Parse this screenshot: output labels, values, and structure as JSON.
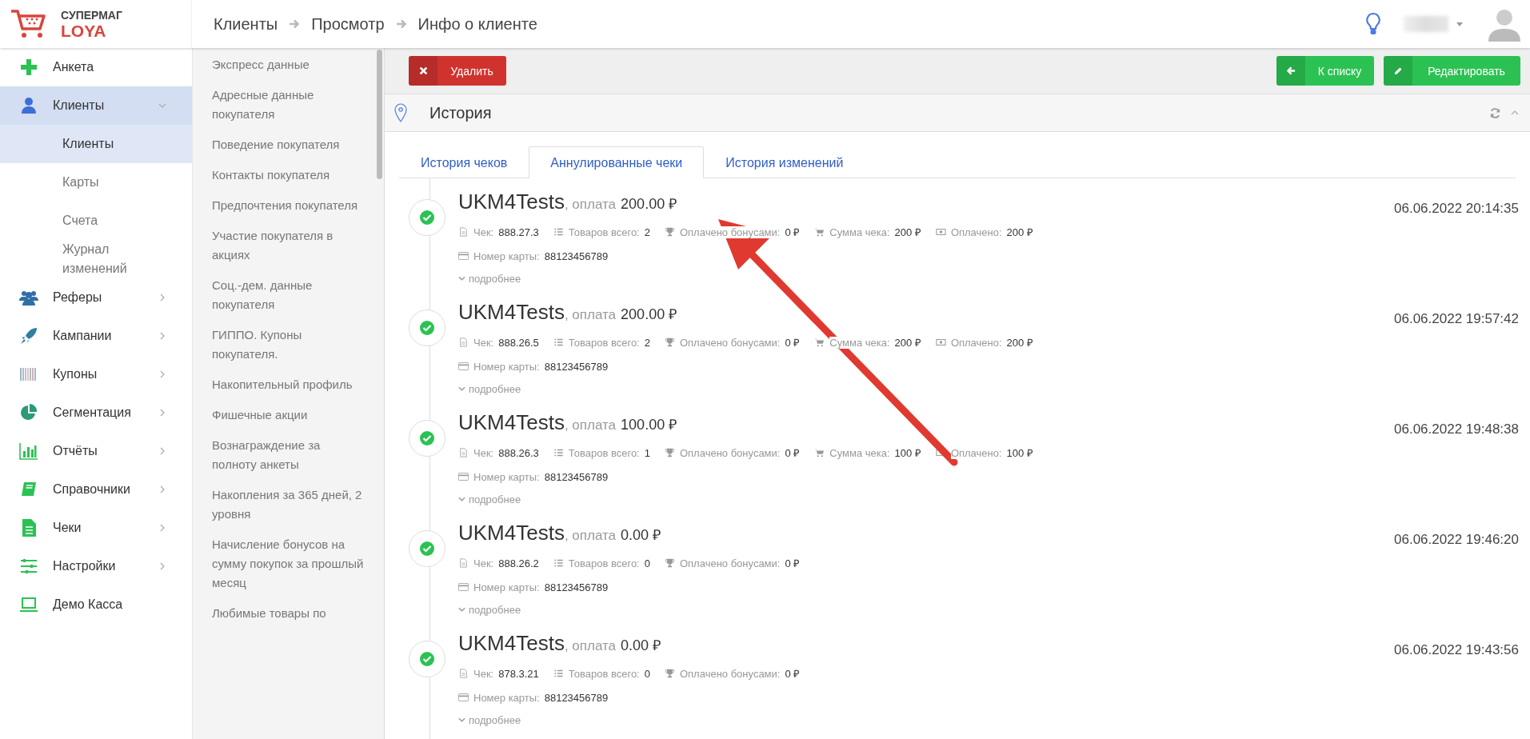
{
  "logo": {
    "top": "СУПЕРМАГ",
    "bottom": "LOYA"
  },
  "breadcrumbs": [
    "Клиенты",
    "Просмотр",
    "Инфо о клиенте"
  ],
  "sidebar": {
    "items": [
      {
        "label": "Анкета",
        "selected": false
      },
      {
        "label": "Клиенты",
        "selected": true,
        "expanded": true,
        "children": [
          {
            "label": "Клиенты",
            "selected": true
          },
          {
            "label": "Карты",
            "selected": false
          },
          {
            "label": "Счета",
            "selected": false
          },
          {
            "label": "Журнал изменений",
            "selected": false
          }
        ]
      },
      {
        "label": "Реферы",
        "selected": false,
        "expanded": false
      },
      {
        "label": "Кампании",
        "selected": false,
        "expanded": false
      },
      {
        "label": "Купоны",
        "selected": false,
        "expanded": false
      },
      {
        "label": "Сегментация",
        "selected": false,
        "expanded": false
      },
      {
        "label": "Отчёты",
        "selected": false,
        "expanded": false
      },
      {
        "label": "Справочники",
        "selected": false,
        "expanded": false
      },
      {
        "label": "Чеки",
        "selected": false,
        "expanded": false
      },
      {
        "label": "Настройки",
        "selected": false,
        "expanded": false
      },
      {
        "label": "Демо Касса",
        "selected": false
      }
    ]
  },
  "submenu": {
    "items": [
      "Экспресс данные",
      "Адресные данные покупателя",
      "Поведение покупателя",
      "Контакты покупателя",
      "Предпочтения покупателя",
      "Участие покупателя в акциях",
      "Соц.-дем. данные покупателя",
      "ГИППО. Купоны покупателя.",
      "Накопительный профиль",
      "Фишечные акции",
      "Вознаграждение за полноту анкеты",
      "Накопления за 365 дней, 2 уровня",
      "Начисление бонусов на сумму покупок за прошлый месяц",
      "Любимые товары по"
    ]
  },
  "actions": {
    "delete": "Удалить",
    "back": "К списку",
    "edit": "Редактировать"
  },
  "panel": {
    "title": "История"
  },
  "tabs": [
    {
      "label": "История чеков",
      "selected": false
    },
    {
      "label": "Аннулированные чеки",
      "selected": true
    },
    {
      "label": "История изменений",
      "selected": false
    }
  ],
  "records": [
    {
      "name": "UKM4Tests",
      "pay_label": ", оплата",
      "amount": "200.00 ₽",
      "time": "06.06.2022 20:14:35",
      "fields": [
        {
          "kind": "receipt",
          "label": "Чек:",
          "value": "888.27.3"
        },
        {
          "kind": "list",
          "label": "Товаров всего:",
          "value": "2"
        },
        {
          "kind": "trophy",
          "label": "Оплачено бонусами:",
          "value": "0 ₽"
        },
        {
          "kind": "cart",
          "label": "Сумма чека:",
          "value": "200 ₽"
        },
        {
          "kind": "cash",
          "label": "Оплачено:",
          "value": "200 ₽"
        }
      ],
      "card_label": "Номер карты:",
      "card": "88123456789",
      "more": "подробнее"
    },
    {
      "name": "UKM4Tests",
      "pay_label": ", оплата",
      "amount": "200.00 ₽",
      "time": "06.06.2022 19:57:42",
      "fields": [
        {
          "kind": "receipt",
          "label": "Чек:",
          "value": "888.26.5"
        },
        {
          "kind": "list",
          "label": "Товаров всего:",
          "value": "2"
        },
        {
          "kind": "trophy",
          "label": "Оплачено бонусами:",
          "value": "0 ₽"
        },
        {
          "kind": "cart",
          "label": "Сумма чека:",
          "value": "200 ₽"
        },
        {
          "kind": "cash",
          "label": "Оплачено:",
          "value": "200 ₽"
        }
      ],
      "card_label": "Номер карты:",
      "card": "88123456789",
      "more": "подробнее"
    },
    {
      "name": "UKM4Tests",
      "pay_label": ", оплата",
      "amount": "100.00 ₽",
      "time": "06.06.2022 19:48:38",
      "fields": [
        {
          "kind": "receipt",
          "label": "Чек:",
          "value": "888.26.3"
        },
        {
          "kind": "list",
          "label": "Товаров всего:",
          "value": "1"
        },
        {
          "kind": "trophy",
          "label": "Оплачено бонусами:",
          "value": "0 ₽"
        },
        {
          "kind": "cart",
          "label": "Сумма чека:",
          "value": "100 ₽"
        },
        {
          "kind": "cash",
          "label": "Оплачено:",
          "value": "100 ₽"
        }
      ],
      "card_label": "Номер карты:",
      "card": "88123456789",
      "more": "подробнее"
    },
    {
      "name": "UKM4Tests",
      "pay_label": ", оплата",
      "amount": "0.00 ₽",
      "time": "06.06.2022 19:46:20",
      "fields": [
        {
          "kind": "receipt",
          "label": "Чек:",
          "value": "888.26.2"
        },
        {
          "kind": "list",
          "label": "Товаров всего:",
          "value": "0"
        },
        {
          "kind": "trophy",
          "label": "Оплачено бонусами:",
          "value": "0 ₽"
        }
      ],
      "card_label": "Номер карты:",
      "card": "88123456789",
      "more": "подробнее"
    },
    {
      "name": "UKM4Tests",
      "pay_label": ", оплата",
      "amount": "0.00 ₽",
      "time": "06.06.2022 19:43:56",
      "fields": [
        {
          "kind": "receipt",
          "label": "Чек:",
          "value": "878.3.21"
        },
        {
          "kind": "list",
          "label": "Товаров всего:",
          "value": "0"
        },
        {
          "kind": "trophy",
          "label": "Оплачено бонусами:",
          "value": "0 ₽"
        }
      ],
      "card_label": "Номер карты:",
      "card": "88123456789",
      "more": "подробнее"
    }
  ]
}
